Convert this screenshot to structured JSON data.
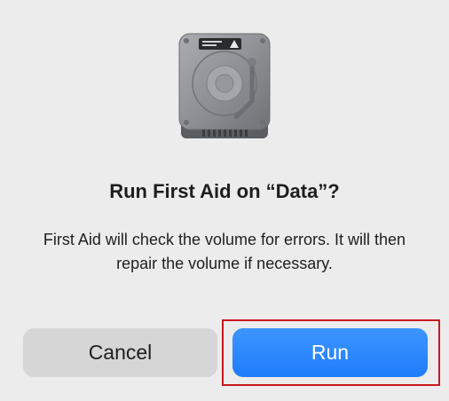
{
  "dialog": {
    "title": "Run First Aid on “Data”?",
    "message": "First Aid will check the volume for errors. It will then repair the volume if necessary.",
    "icon": "hard-drive-icon"
  },
  "buttons": {
    "cancel_label": "Cancel",
    "run_label": "Run"
  },
  "colors": {
    "background": "#ececec",
    "accent": "#1f7dfb",
    "cancel_button": "#d6d6d6",
    "highlight": "#c8191e"
  }
}
